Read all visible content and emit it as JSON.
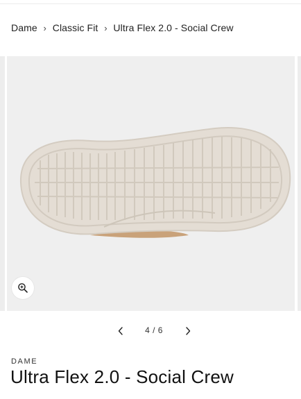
{
  "breadcrumb": {
    "items": [
      "Dame",
      "Classic Fit",
      "Ultra Flex 2.0 - Social Crew"
    ],
    "separator": "›"
  },
  "gallery": {
    "image_alt": "Ultra Flex 2.0 - Social Crew shoe outsole",
    "background_color": "#efefef",
    "sole_color": "#e4ddd4",
    "upper_color": "#c9a27a",
    "zoom_icon": "zoom-in-icon",
    "current": "4",
    "total": "6",
    "counter_text": "4 / 6",
    "prev_icon": "chevron-left-icon",
    "next_icon": "chevron-right-icon"
  },
  "product": {
    "vendor": "DAME",
    "title": "Ultra Flex 2.0 - Social Crew"
  }
}
